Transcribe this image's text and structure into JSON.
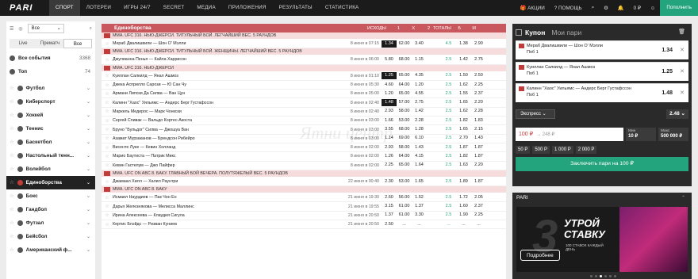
{
  "nav": {
    "logo": "PARI",
    "items": [
      "СПОРТ",
      "ЛОТЕРЕИ",
      "ИГРЫ 24/7",
      "SECRET",
      "МЕДИА",
      "ПРИЛОЖЕНИЯ",
      "РЕЗУЛЬТАТЫ",
      "СТАТИСТИКА"
    ],
    "promo": "АКЦИИ",
    "help": "ПОМОЩЬ",
    "balance": "0 ₽",
    "deposit": "Пополнить"
  },
  "sidebar": {
    "filter": "Все",
    "tabs": [
      "Live",
      "Прематч",
      "Все"
    ],
    "all_events": "Все события",
    "all_count": "3368",
    "top": "Топ",
    "top_count": "74",
    "sports": [
      "Футбол",
      "Киберспорт",
      "Хоккей",
      "Теннис",
      "Баскетбол",
      "Настольный тенн...",
      "Волейбол",
      "Единоборства",
      "Бокс",
      "Гандбол",
      "Футзал",
      "Бейсбол",
      "Американский ф..."
    ]
  },
  "main": {
    "title": "Единоборства",
    "col_outcomes": "ИСХОДЫ",
    "col_totals": "ТОТАЛЫ",
    "col_1": "1",
    "col_x": "X",
    "col_2": "2",
    "col_b": "Б",
    "col_m": "М",
    "groups": [
      {
        "title": "ММА. UFC 316. НЬЮ-ДЖЕРСИ. ТИТУЛЬНЫЙ БОЙ. ЛЕГЧАЙШИЙ ВЕС. 5 РАУНДОВ",
        "rows": [
          [
            "Мераб Двалишвили — Шон О' Мэлли",
            "8 июня в 07:15",
            "1.34",
            "62.00",
            "3.40",
            "4.5",
            "1.38",
            "2.90"
          ]
        ]
      },
      {
        "title": "ММА. UFC 316. НЬЮ-ДЖЕРСИ. ТИТУЛЬНЫЙ БОЙ. ЖЕНЩИНЫ. ЛЕГЧАЙШИЙ ВЕС. 5 РАУНДОВ",
        "rows": [
          [
            "Джулианна Пенья — Кайла Харрисон",
            "8 июня в 06:00",
            "5.80",
            "68.00",
            "1.15",
            "2.5",
            "1.42",
            "2.75"
          ]
        ]
      },
      {
        "title": "ММА. UFC 316. НЬЮ-ДЖЕРСИ",
        "rows": [
          [
            "Куиллан Салкилд — Янал Ашмоз",
            "8 июня в 01:10",
            "1.25",
            "65.00",
            "4.35",
            "2.5",
            "1.50",
            "2.50"
          ],
          [
            "Джека Асприлло Сарози — Ю Сан Чу",
            "8 июня в 05:30",
            "4.60",
            "64.00",
            "1.20",
            "2.5",
            "1.62",
            "2.25"
          ],
          [
            "Армани Липски Да Силва — Ван Цун",
            "8 июня в 05:00",
            "1.20",
            "65.00",
            "4.55",
            "2.5",
            "1.55",
            "2.37"
          ],
          [
            "Калинн \"Хаос\" Уильямс — Андерс Берг Густафссон",
            "8 июня в 02:40",
            "1.48",
            "57.00",
            "2.75",
            "2.5",
            "1.65",
            "2.20"
          ],
          [
            "Маркель Медерос — Марк Чонкски",
            "8 июня в 02:40",
            "2.93",
            "58.00",
            "1.42",
            "2.5",
            "1.62",
            "2.28"
          ],
          [
            "Сергей Спивак — Вальдо Кортес-Акоста",
            "8 июня в 03:00",
            "1.66",
            "53.00",
            "2.28",
            "2.5",
            "1.82",
            "1.83"
          ],
          [
            "Бруно \"Бульдог\" Силва — Джошуа Ван",
            "8 июня в 03:00",
            "3.55",
            "68.00",
            "1.28",
            "2.5",
            "1.65",
            "2.15"
          ],
          [
            "Азамат Мурзаканов — Брендсон Рибейро",
            "8 июня в 03:00",
            "1.14",
            "69.00",
            "6.10",
            "2.5",
            "2.70",
            "1.43"
          ],
          [
            "Висенте Луке — Кевин Холланд",
            "8 июня в 02:00",
            "2.93",
            "58.00",
            "1.43",
            "2.5",
            "1.87",
            "1.87"
          ],
          [
            "Марио Баутиста — Патрик Микс",
            "8 июня в 02:00",
            "1.26",
            "64.00",
            "4.15",
            "2.5",
            "1.82",
            "1.87"
          ],
          [
            "Кевин Гастелум — Джо Пайфер",
            "8 июня в 02:00",
            "2.25",
            "65.00",
            "1.64",
            "2.5",
            "1.63",
            "2.20"
          ]
        ]
      },
      {
        "title": "ММА. UFC ON ABC 8. БАКУ. ГЛАВНЫЙ БОЙ ВЕЧЕРА. ПОЛУТЯЖЕЛЫЙ ВЕС. 5 РАУНДОВ",
        "rows": [
          [
            "Джамаал Хилл — Халил Раунтри",
            "22 июня в 00:40",
            "2.30",
            "53.00",
            "1.65",
            "2.5",
            "1.89",
            "1.87"
          ]
        ]
      },
      {
        "title": "ММА. UFC ON ABC 8. БАКУ",
        "rows": [
          [
            "Исмаил Наурдиев — Пак Чон Ен",
            "21 июня в 19:30",
            "2.60",
            "56.00",
            "1.52",
            "2.5",
            "1.72",
            "2.05"
          ],
          [
            "Дарья Железнякова — Мелисса Маллинс",
            "21 июня в 19:55",
            "3.15",
            "61.00",
            "1.37",
            "2.5",
            "1.60",
            "2.37"
          ],
          [
            "Ирина Алексеева — Клаудия Сигула",
            "21 июня в 20:50",
            "1.37",
            "61.00",
            "3.30",
            "2.5",
            "1.90",
            "2.25"
          ],
          [
            "Кертис Блэйдс — Ризван Куниев",
            "21 июня в 20:50",
            "2.50",
            "...",
            "...",
            "...",
            "...",
            "..."
          ]
        ]
      }
    ]
  },
  "coupon": {
    "tab1": "Купон",
    "tab2": "Мои пари",
    "selections": [
      {
        "match": "Мераб Двалишвили — Шон О' Мэлли",
        "pick": "Поб 1",
        "odd": "1.34"
      },
      {
        "match": "Куиллан Салкилд — Янал Ашмоз",
        "pick": "Поб 1",
        "odd": "1.25"
      },
      {
        "match": "Калинн \"Хаос\" Уильямс — Андерс Берг Густафссон",
        "pick": "Поб 1",
        "odd": "1.48"
      }
    ],
    "type": "Экспресс",
    "total": "2.48",
    "amount": "100 ₽",
    "win": "→ 248 ₽",
    "min_label": "Мин",
    "min_value": "10 ₽",
    "max_label": "Макс",
    "max_value": "500 000 ₽",
    "quick": [
      "50 Р",
      "500 Р",
      "1 000 Р",
      "2 000 Р"
    ],
    "submit": "Заключить пари на 100 ₽"
  },
  "promo": {
    "title": "PARI",
    "big_text": "УТРОЙ СТАВКУ",
    "sub": "100 СТАВОК КАЖДЫЙ ДЕНЬ",
    "button": "Подробнее",
    "slide": "3"
  },
  "watermark": "Ятни центр"
}
